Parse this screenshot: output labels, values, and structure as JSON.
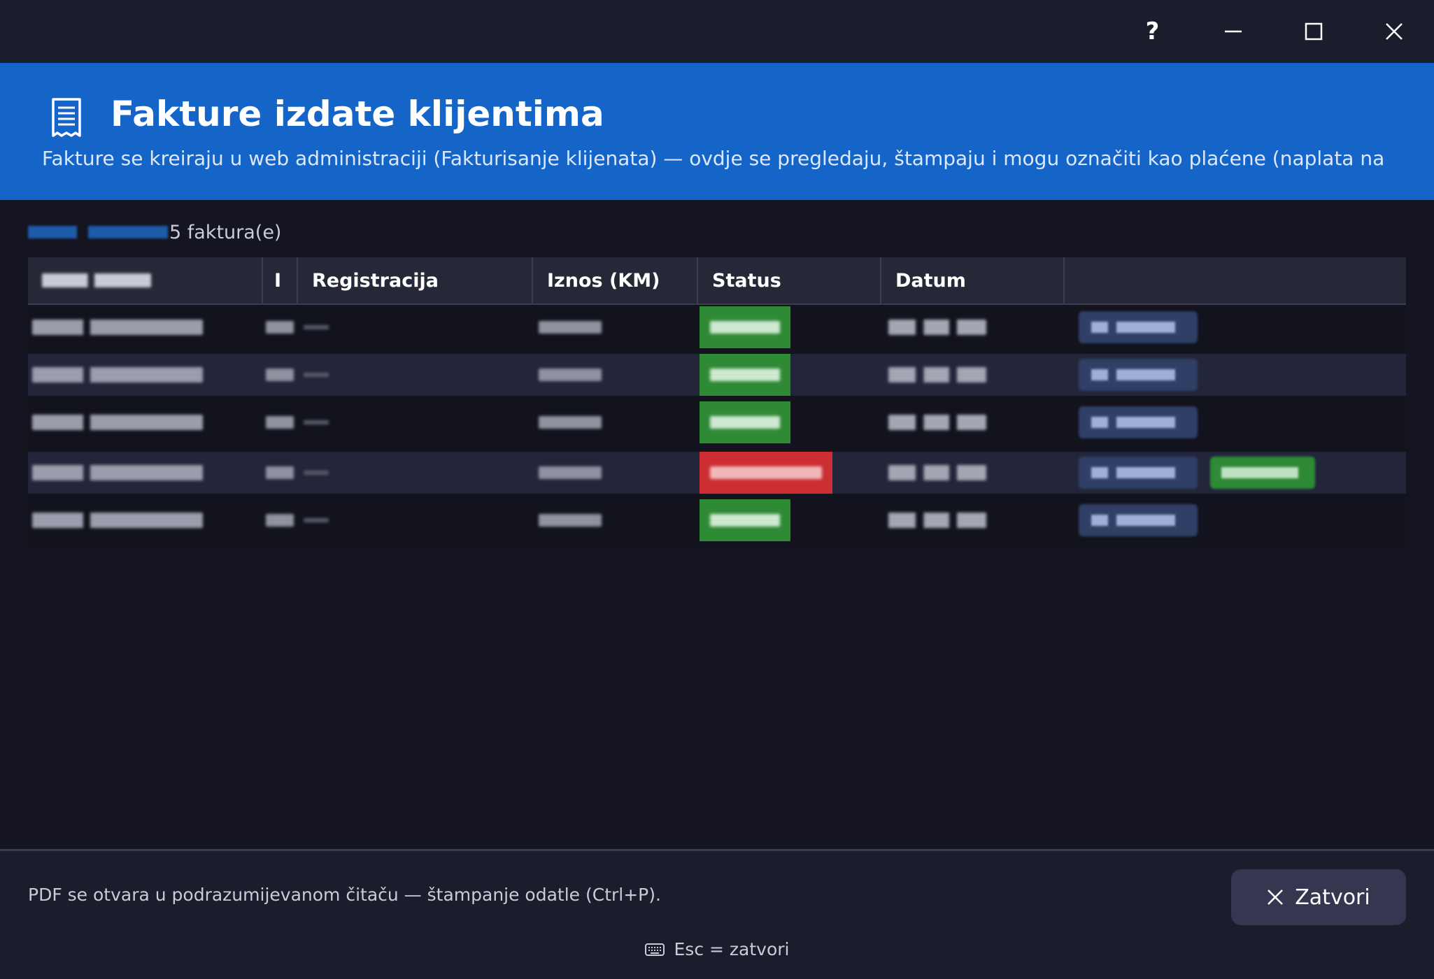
{
  "window": {
    "help_label": "?"
  },
  "header": {
    "icon": "receipt-icon",
    "title": "Fakture izdate klijentima",
    "subtitle": "Fakture se kreiraju u web administraciji (Fakturisanje klijenata) — ovdje se pregledaju, štampaju i mogu označiti kao plaćene (naplata na licu mjesta"
  },
  "summary": {
    "count_text": "5 faktura(e)"
  },
  "table": {
    "columns": [
      "",
      "I",
      "Registracija",
      "Iznos (KM)",
      "Status",
      "Datum",
      ""
    ],
    "rows": [
      {
        "status": "paid",
        "status_color": "#2f8a36",
        "has_paid_action": false
      },
      {
        "status": "paid",
        "status_color": "#2f8a36",
        "has_paid_action": false
      },
      {
        "status": "paid",
        "status_color": "#2f8a36",
        "has_paid_action": false
      },
      {
        "status": "unpaid",
        "status_color": "#cc2e34",
        "has_paid_action": true
      },
      {
        "status": "paid",
        "status_color": "#2f8a36",
        "has_paid_action": false
      }
    ]
  },
  "footer": {
    "note": "PDF se otvara u podrazumijevanom čitaču — štampanje odatle (Ctrl+P).",
    "close_label": "Zatvori",
    "keyboard_hint": "Esc = zatvori"
  },
  "colors": {
    "accent": "#1565c8",
    "background": "#141521",
    "paid": "#2f8a36",
    "unpaid": "#cc2e34"
  }
}
